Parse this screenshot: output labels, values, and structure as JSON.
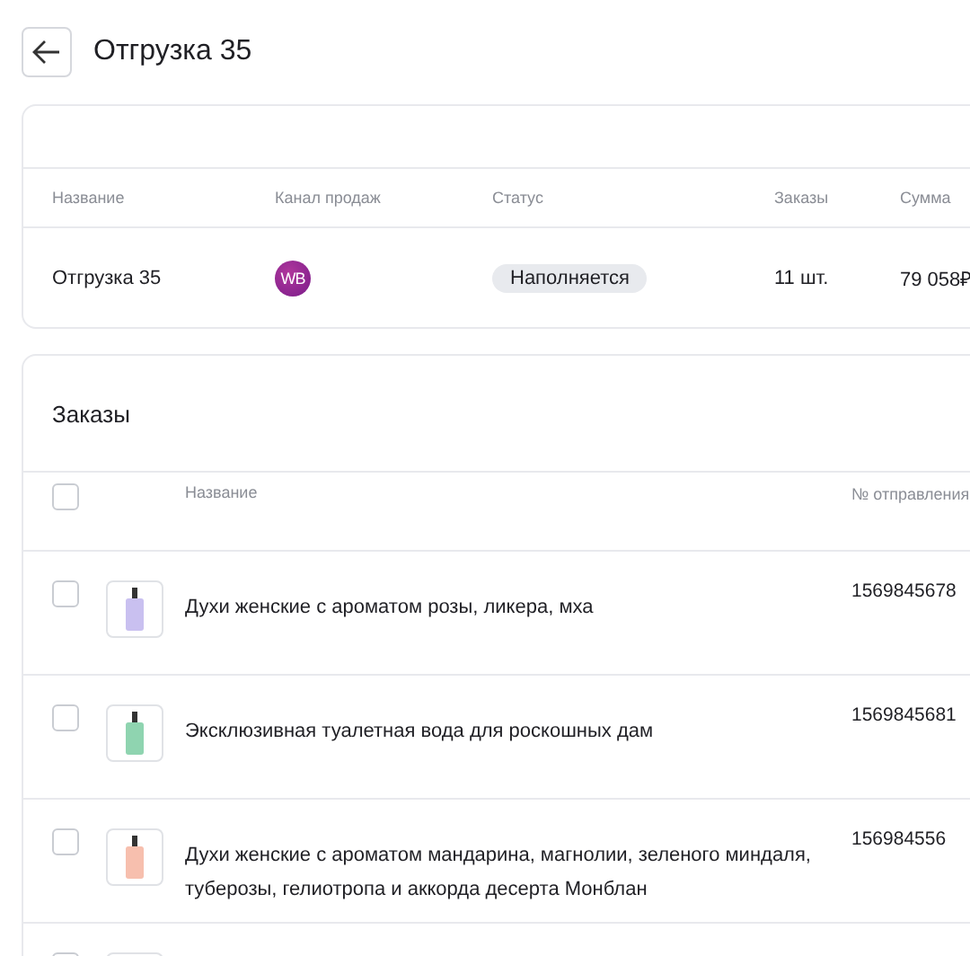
{
  "header": {
    "title": "Отгрузка 35"
  },
  "shipment": {
    "columns": [
      "Название",
      "Канал продаж",
      "Статус",
      "Заказы",
      "Сумма"
    ],
    "row": {
      "name": "Отгрузка 35",
      "channel": "WB",
      "status": "Наполняется",
      "orders": "11 шт.",
      "sum": "79 058₽"
    }
  },
  "orders": {
    "title": "Заказы",
    "columns": [
      "Название",
      "№ отправления"
    ],
    "all_checked": false,
    "rows": [
      {
        "checked": false,
        "name": "Духи женские с ароматом розы, ликера, мха",
        "number": "1569845678",
        "color": "#c9c0f0"
      },
      {
        "checked": false,
        "name": "Эксклюзивная туалетная вода для роскошных дам",
        "number": "1569845681",
        "color": "#8fd4b0"
      },
      {
        "checked": false,
        "name": "Духи женские с ароматом мандарина, магнолии, зеленого миндаля, туберозы, гелиотропа и аккорда десерта Монблан",
        "number": "156984556",
        "color": "#f7bfae"
      },
      {
        "checked": false
      }
    ]
  }
}
